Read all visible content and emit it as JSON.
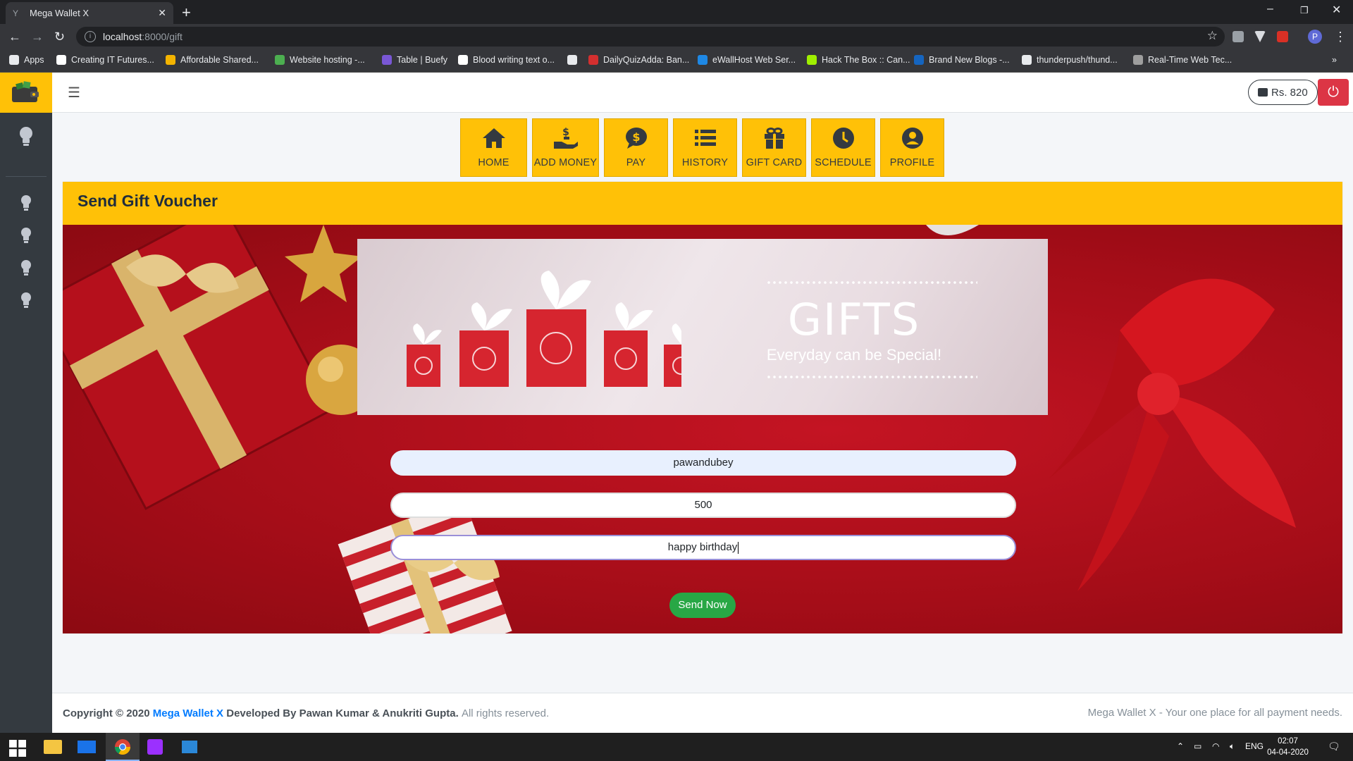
{
  "browser": {
    "tab_title": "Mega Wallet X",
    "url_host": "localhost",
    "url_path": ":8000/gift",
    "profile_initial": "P",
    "bookmarks": [
      {
        "label": "Apps",
        "color": "#e8eaed"
      },
      {
        "label": "Creating IT Futures...",
        "color": "#ffffff"
      },
      {
        "label": "Affordable Shared...",
        "color": "#f4b400"
      },
      {
        "label": "Website hosting -...",
        "color": "#4caf50"
      },
      {
        "label": "Table | Buefy",
        "color": "#7957d5"
      },
      {
        "label": "Blood writing text o...",
        "color": "#ffffff"
      },
      {
        "label": "",
        "color": "#e8eaed"
      },
      {
        "label": "DailyQuizAdda: Ban...",
        "color": "#d32f2f"
      },
      {
        "label": "eWallHost Web Ser...",
        "color": "#1e88e5"
      },
      {
        "label": "Hack The Box :: Can...",
        "color": "#9fef00"
      },
      {
        "label": "Brand New Blogs -...",
        "color": "#1565c0"
      },
      {
        "label": "thunderpush/thund...",
        "color": "#e8eaed"
      },
      {
        "label": "Real-Time Web Tec...",
        "color": "#9e9e9e"
      }
    ]
  },
  "header": {
    "balance": "Rs. 820"
  },
  "menu": [
    {
      "label": "HOME",
      "icon": "home-icon"
    },
    {
      "label": "ADD MONEY",
      "icon": "hand-money-icon"
    },
    {
      "label": "PAY",
      "icon": "dollar-bubble-icon"
    },
    {
      "label": "HISTORY",
      "icon": "list-icon"
    },
    {
      "label": "GIFT CARD",
      "icon": "gift-icon"
    },
    {
      "label": "SCHEDULE",
      "icon": "clock-icon"
    },
    {
      "label": "PROFILE",
      "icon": "user-circle-icon"
    }
  ],
  "card": {
    "title": "Send Gift Voucher",
    "banner_title": "GIFTS",
    "banner_subtitle": "Everyday can be Special!"
  },
  "form": {
    "recipient": "pawandubey",
    "amount": "500",
    "message": "happy birthday",
    "submit_label": "Send Now"
  },
  "footer": {
    "copyright_prefix": "Copyright © 2020",
    "brand": "Mega Wallet X",
    "developed_by": "Developed By Pawan Kumar & Anukriti Gupta.",
    "rights": "All rights reserved.",
    "tagline": "Mega Wallet X - Your one place for all payment needs."
  },
  "taskbar": {
    "lang": "ENG",
    "time": "02:07",
    "date": "04-04-2020"
  },
  "colors": {
    "accent": "#ffc107",
    "sidebar": "#343a40",
    "success": "#28a745",
    "danger": "#dc3545",
    "brand_link": "#007bff"
  }
}
